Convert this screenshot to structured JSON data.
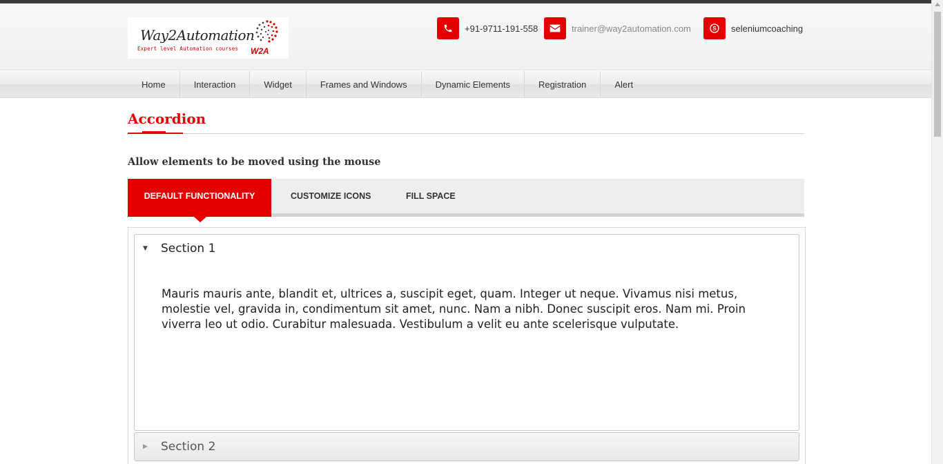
{
  "brand": {
    "name": "Way2Automation",
    "tagline": "Expert level Automation courses",
    "mark": "W2A"
  },
  "contacts": {
    "phone": "+91-9711-191-558",
    "email": "trainer@way2automation.com",
    "skype": "seleniumcoaching"
  },
  "nav": {
    "items": [
      "Home",
      "Interaction",
      "Widget",
      "Frames and Windows",
      "Dynamic Elements",
      "Registration",
      "Alert"
    ]
  },
  "page": {
    "title": "Accordion",
    "subtitle": "Allow elements to be moved using the mouse"
  },
  "tabs": {
    "items": [
      "DEFAULT FUNCTIONALITY",
      "CUSTOMIZE ICONS",
      "FILL SPACE"
    ],
    "active": "DEFAULT FUNCTIONALITY"
  },
  "accordion": {
    "sections": [
      {
        "label": "Section 1",
        "expanded": true,
        "content": "Mauris mauris ante, blandit et, ultrices a, suscipit eget, quam. Integer ut neque. Vivamus nisi metus, molestie vel, gravida in, condimentum sit amet, nunc. Nam a nibh. Donec suscipit eros. Nam mi. Proin viverra leo ut odio. Curabitur malesuada. Vestibulum a velit eu ante scelerisque vulputate."
      },
      {
        "label": "Section 2",
        "expanded": false
      }
    ]
  },
  "colors": {
    "accent": "#e40000",
    "nav_bg": "#ececec",
    "text": "#333333"
  },
  "icons": {
    "phone": "phone-icon",
    "email": "envelope-icon",
    "skype": "skype-icon",
    "expanded": "triangle-down-icon",
    "collapsed": "triangle-right-icon"
  }
}
